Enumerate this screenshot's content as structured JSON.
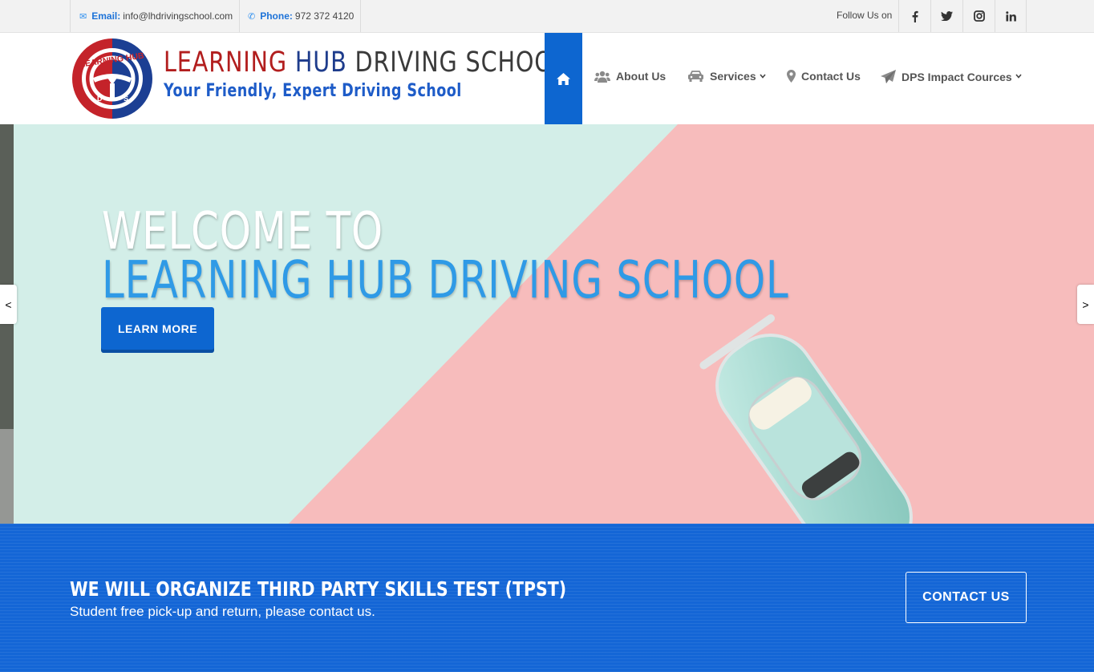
{
  "topbar": {
    "email_label": "Email:",
    "email_value": "info@lhdrivingschool.com",
    "phone_label": "Phone:",
    "phone_value": "972 372 4120",
    "follow_text": "Follow Us on",
    "social": [
      {
        "icon": "facebook-icon",
        "glyph": "f"
      },
      {
        "icon": "twitter-icon",
        "glyph": "t"
      },
      {
        "icon": "instagram-icon",
        "glyph": "ig"
      },
      {
        "icon": "linkedin-icon",
        "glyph": "in"
      }
    ]
  },
  "header": {
    "logo_text": "LEARNING HUB",
    "logo_letters": [
      "D",
      "S"
    ],
    "brand_word1": "LEARNING",
    "brand_word2": "HUB",
    "brand_word3": "DRIVING SCHOOL",
    "tagline": "Your Friendly, Expert Driving School"
  },
  "nav": {
    "home_icon": "home-icon",
    "items": [
      {
        "label": "About Us",
        "icon": "users-icon",
        "has_dropdown": false
      },
      {
        "label": "Services",
        "icon": "car-icon",
        "has_dropdown": true
      },
      {
        "label": "Contact Us",
        "icon": "map-marker-icon",
        "has_dropdown": false
      },
      {
        "label": "DPS Impact Cources",
        "icon": "paper-plane-icon",
        "has_dropdown": true
      }
    ]
  },
  "hero": {
    "line1": "WELCOME TO",
    "line2": "LEARNING HUB DRIVING SCHOOL",
    "button": "LEARN MORE",
    "prev_arrow": "<",
    "next_arrow": ">"
  },
  "callout": {
    "title": "WE WILL ORGANIZE THIRD PARTY SKILLS TEST (TPST)",
    "subtitle": "Student free pick-up and return, please contact us.",
    "button": "CONTACT US"
  },
  "colors": {
    "accent_blue": "#0d66d0",
    "brand_red": "#b21e1e",
    "brand_navy": "#1e3c8c",
    "hero_mint": "#d3eee8",
    "hero_pink": "#f7bcbc",
    "hero_title_blue": "#2f9ae6"
  }
}
